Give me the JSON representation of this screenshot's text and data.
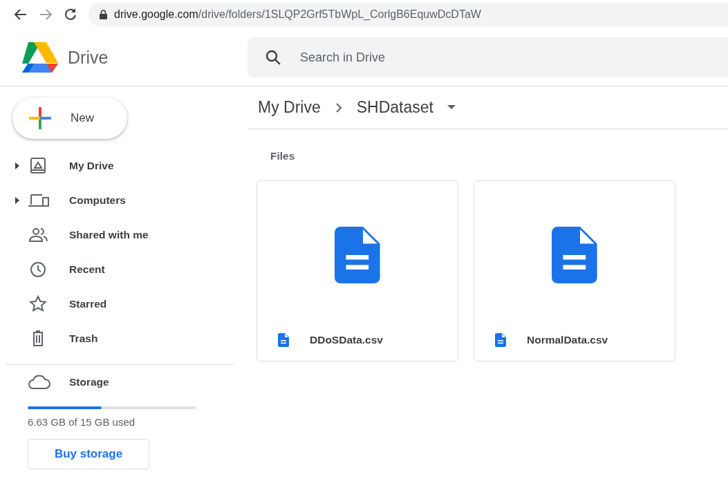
{
  "browser": {
    "url_host": "drive.google.com",
    "url_path": "/drive/folders/1SLQP2Grf5TbWpL_CorlgB6EquwDcDTaW"
  },
  "app": {
    "title": "Drive"
  },
  "search": {
    "placeholder": "Search in Drive"
  },
  "new_button": {
    "label": "New"
  },
  "sidebar": {
    "items": [
      {
        "label": "My Drive",
        "kind": "drive",
        "expandable": true
      },
      {
        "label": "Computers",
        "kind": "computers",
        "expandable": true
      },
      {
        "label": "Shared with me",
        "kind": "shared",
        "expandable": false
      },
      {
        "label": "Recent",
        "kind": "recent",
        "expandable": false
      },
      {
        "label": "Starred",
        "kind": "starred",
        "expandable": false
      },
      {
        "label": "Trash",
        "kind": "trash",
        "expandable": false
      }
    ]
  },
  "storage": {
    "label": "Storage",
    "level": 0.44,
    "usage": "6.63 GB of 15 GB used",
    "button": "Buy storage"
  },
  "breadcrumb": [
    "My Drive",
    "SHDataset"
  ],
  "section": {
    "title": "Files"
  },
  "files": [
    {
      "name": "DDoSData.csv"
    },
    {
      "name": "NormalData.csv"
    }
  ]
}
